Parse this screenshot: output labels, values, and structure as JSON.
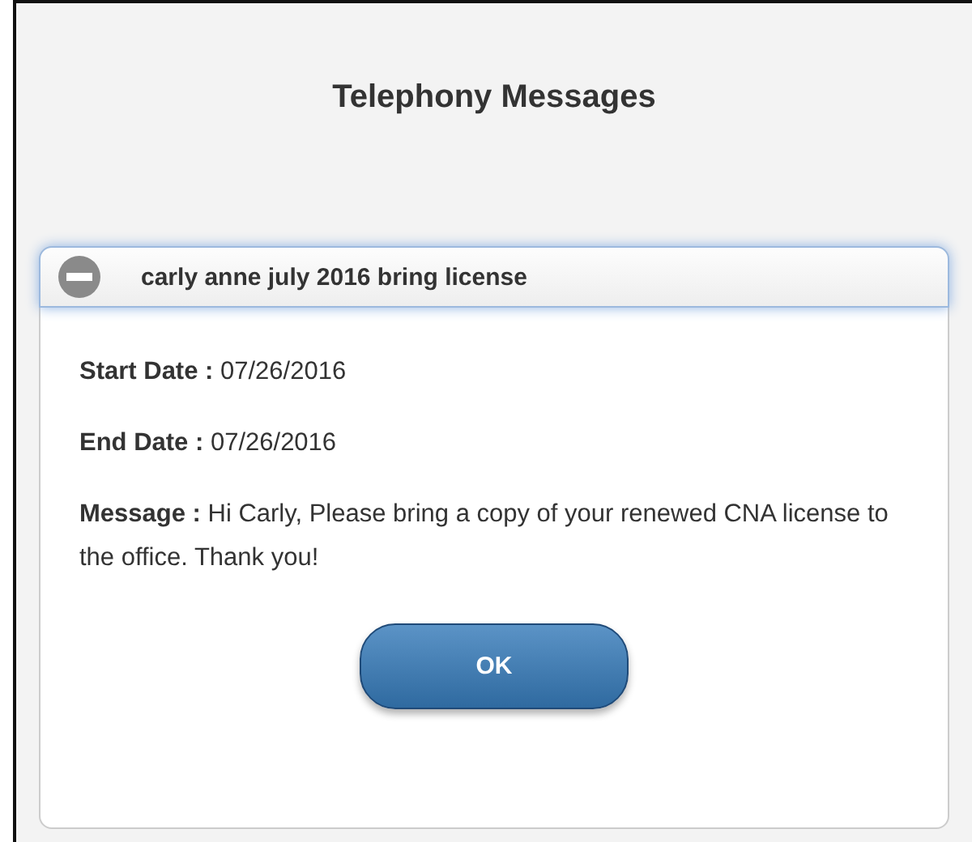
{
  "title": "Telephony Messages",
  "message": {
    "subject": "carly anne july 2016 bring license",
    "expanded": true,
    "fields": [
      {
        "label": "Start Date :",
        "value": "07/26/2016"
      },
      {
        "label": "End Date :",
        "value": "07/26/2016"
      },
      {
        "label": "Message :",
        "value": "Hi Carly, Please bring a copy of your renewed CNA license to the office. Thank you!"
      }
    ]
  },
  "buttons": [
    "OK"
  ]
}
